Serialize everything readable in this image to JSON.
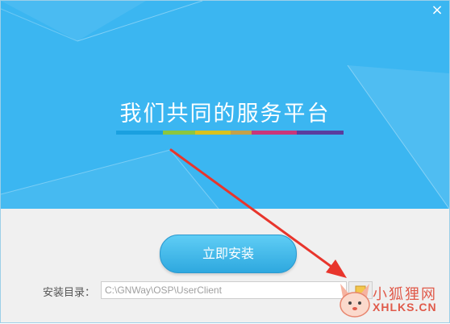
{
  "window": {
    "close_glyph": "×"
  },
  "banner": {
    "title": "我们共同的服务平台",
    "stripe_colors": [
      "#1aa0e0",
      "#1aa0e0",
      "#8cc63f",
      "#d9c21e",
      "#c4a14a",
      "#c8367a",
      "#5a3c9e"
    ],
    "background_color": "#3bb6f1"
  },
  "install": {
    "button_label": "立即安装"
  },
  "directory": {
    "label": "安装目录：",
    "value": "C:\\GNWay\\OSP\\UserClient"
  },
  "watermark": {
    "text_cn": "小狐狸网",
    "text_en": "XHLKS.CN",
    "icon": "fox-logo"
  },
  "annotation": {
    "arrow_color": "#e8352c",
    "arrow_icon": "red-arrow"
  }
}
